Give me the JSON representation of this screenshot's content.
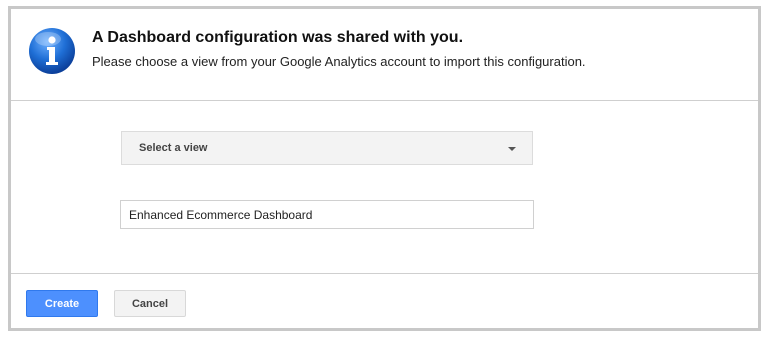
{
  "dialog": {
    "title": "A Dashboard configuration was shared with you.",
    "subtitle": "Please choose a view from your Google Analytics account to import this configuration.",
    "icon": "info-icon",
    "icon_color": "#1a66c9"
  },
  "form": {
    "view_select": {
      "selected_label": "Select a view",
      "icon": "chevron-down-icon"
    },
    "dashboard_name": {
      "value": "Enhanced Ecommerce Dashboard"
    }
  },
  "actions": {
    "create_label": "Create",
    "cancel_label": "Cancel",
    "create_color": "#4d90fe"
  }
}
